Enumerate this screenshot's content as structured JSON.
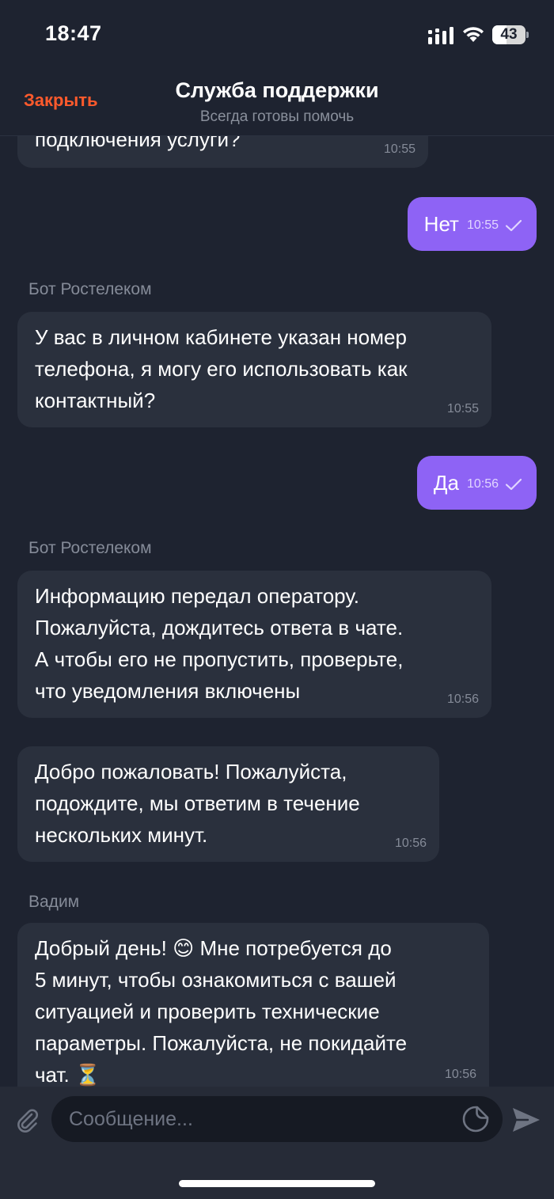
{
  "status_bar": {
    "time": "18:47",
    "battery": "43",
    "battery_level": 0.43
  },
  "header": {
    "close_label": "Закрыть",
    "title": "Служба поддержки",
    "subtitle": "Всегда готовы помочь"
  },
  "messages": [
    {
      "type": "incoming",
      "text": "подключения услуги?",
      "time": "10:55"
    },
    {
      "type": "outgoing",
      "text": "Нет",
      "time": "10:55"
    },
    {
      "type": "incoming",
      "sender": "Бот Ростелеком",
      "text": "У вас в личном кабинете указан номер\nтелефона, я могу его использовать как\nконтактный?",
      "time": "10:55"
    },
    {
      "type": "outgoing",
      "text": "Да",
      "time": "10:56"
    },
    {
      "type": "incoming",
      "sender": "Бот Ростелеком",
      "text": "Информацию передал оператору.\nПожалуйста, дождитесь ответа в чате.\nА чтобы его не пропустить, проверьте,\nчто уведомления включены",
      "time": "10:56"
    },
    {
      "type": "incoming",
      "text": "Добро пожаловать! Пожалуйста,\nподождите, мы ответим в течение\nнескольких минут.",
      "time": "10:56"
    },
    {
      "type": "incoming",
      "sender": "Вадим",
      "text": "Добрый день! 😊 Мне потребуется до\n5 минут, чтобы ознакомиться с вашей\nситуацией и проверить технические\nпараметры. Пожалуйста, не покидайте\nчат. ⏳",
      "time": "10:56"
    }
  ],
  "composer": {
    "placeholder": "Сообщение..."
  },
  "icons": {
    "attach": "paperclip-icon",
    "sticker": "sticker-icon",
    "send": "send-icon",
    "read": "check-icon"
  },
  "colors": {
    "background": "#1e2330",
    "incoming_bubble": "#2a303d",
    "outgoing_bubble": "#8e63f5",
    "accent": "#ff5a2c"
  }
}
